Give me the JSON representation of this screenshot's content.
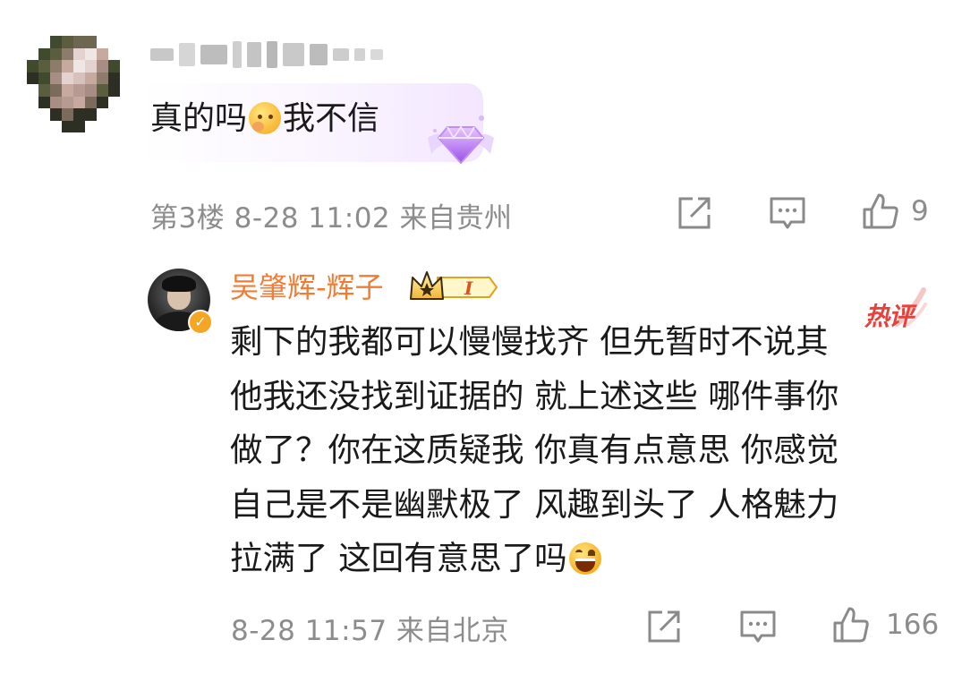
{
  "comment": {
    "author_name_blurred": true,
    "text_before_emoji": "真的吗",
    "emoji_1": "thinking-face-emoji",
    "text_after_emoji": "我不信",
    "floor": "第3楼",
    "datetime": "8-28 11:02",
    "location": "来自贵州",
    "like_count": "9"
  },
  "reply": {
    "author_name": "吴肇辉-辉子",
    "level_badge": "I",
    "hot_tag": "热评",
    "lines": [
      "剩下的我都可以慢慢找齐 但先暂时不说其",
      "他我还没找到证据的 就上述这些 哪件事你",
      "做了？你在这质疑我 你真有点意思 你感觉",
      "自己是不是幽默极了 风趣到头了 人格魅力",
      "拉满了 这回有意思了吗"
    ],
    "emoji_end": "grinning-laugh-emoji",
    "datetime": "8-28 11:57",
    "location": "来自北京",
    "like_count": "166"
  },
  "colors": {
    "meta_gray": "#8c8c8c",
    "author_orange": "#f07c35",
    "hot_red": "#e8413c",
    "icon_gray": "#8a8a8a",
    "gem_purple": "#b06bf0"
  }
}
